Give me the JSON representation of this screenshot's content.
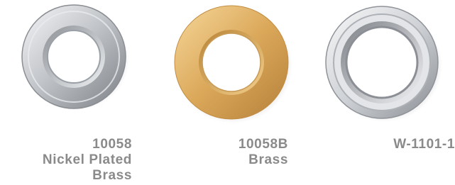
{
  "products": [
    {
      "part_number": "10058",
      "material_lines": [
        "Nickel Plated",
        "Brass"
      ],
      "finish_color": "#c8cacd"
    },
    {
      "part_number": "10058B",
      "material_lines": [
        "Brass"
      ],
      "finish_color": "#dba85a"
    },
    {
      "part_number": "W-1101-1",
      "material_lines": [],
      "finish_color": "#d2d4d8"
    }
  ]
}
